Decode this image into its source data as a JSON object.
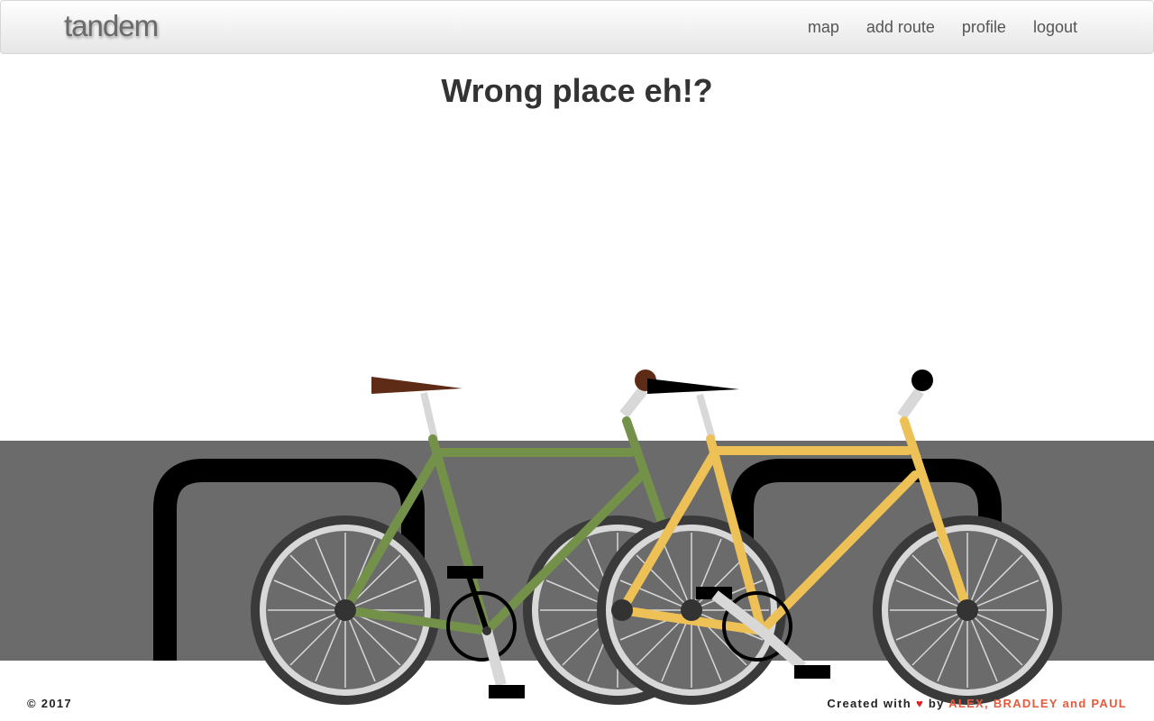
{
  "navbar": {
    "brand": "tandem",
    "links": [
      {
        "label": "map"
      },
      {
        "label": "add route"
      },
      {
        "label": "profile"
      },
      {
        "label": "logout"
      }
    ]
  },
  "main": {
    "title": "Wrong place eh!?"
  },
  "illustration": {
    "icons": [
      "bike-rack-icon",
      "green-bicycle-icon",
      "yellow-bicycle-icon"
    ],
    "colors": {
      "wall": "#6b6b6b",
      "rack": "#000000",
      "green_frame": "#749149",
      "yellow_frame": "#edc156",
      "tire": "#3a3a3a",
      "rim": "#d8d8d8",
      "saddle_brown": "#5e2b16"
    }
  },
  "footer": {
    "copyright": "© 2017",
    "created_prefix": "Created with",
    "heart": "♥",
    "by": "by",
    "authors": "ALEX, BRADLEY and PAUL"
  }
}
